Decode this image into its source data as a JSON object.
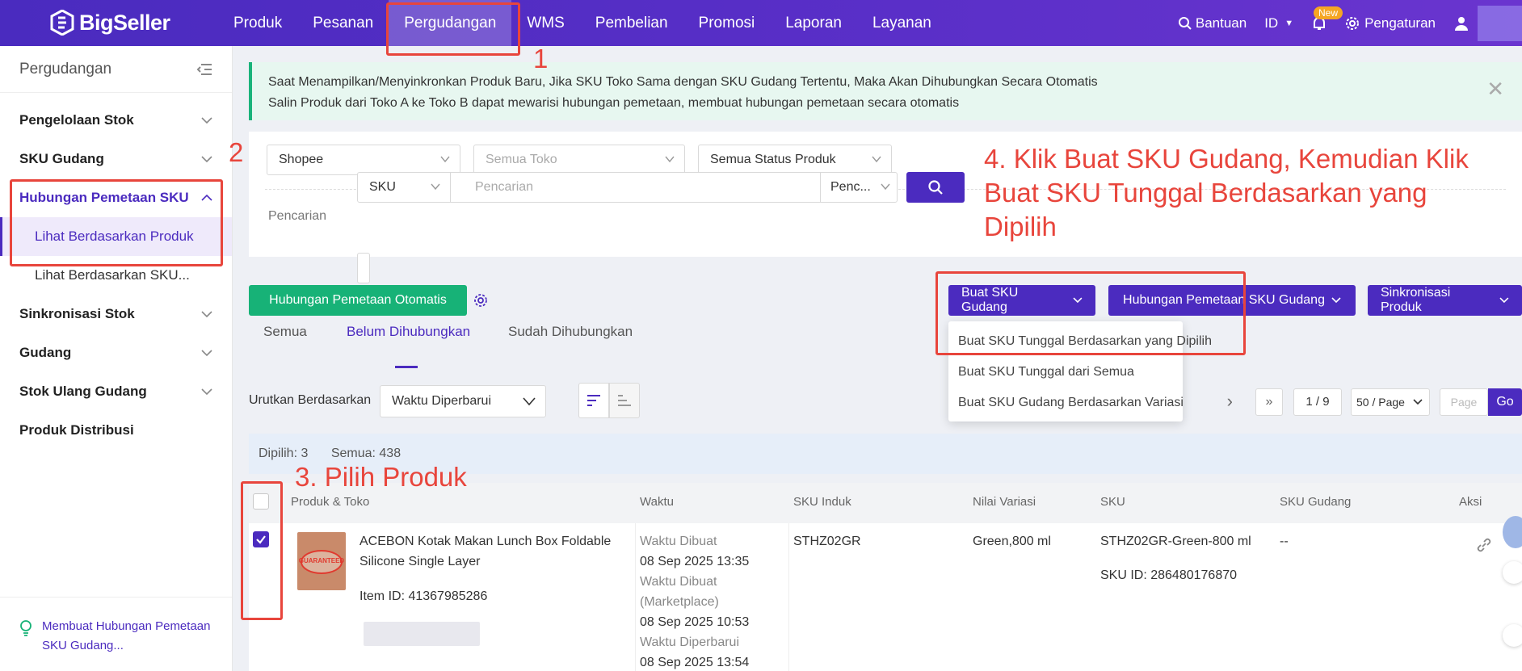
{
  "brand": {
    "name": "BigSeller",
    "accent": "#4b2bbf",
    "green": "#17b277",
    "annotation": "#e8453c"
  },
  "nav": {
    "items": [
      {
        "label": "Produk"
      },
      {
        "label": "Pesanan"
      },
      {
        "label": "Pergudangan"
      },
      {
        "label": "WMS"
      },
      {
        "label": "Pembelian"
      },
      {
        "label": "Promosi"
      },
      {
        "label": "Laporan"
      },
      {
        "label": "Layanan"
      }
    ],
    "active": "Pergudangan",
    "help_label": "Bantuan",
    "lang_label": "ID",
    "new_badge": "New",
    "settings_label": "Pengaturan"
  },
  "sidebar": {
    "title": "Pergudangan",
    "items": [
      {
        "label": "Pengelolaan Stok"
      },
      {
        "label": "SKU Gudang"
      },
      {
        "label": "Hubungan Pemetaan SKU"
      },
      {
        "label": "Sinkronisasi Stok"
      },
      {
        "label": "Gudang"
      },
      {
        "label": "Stok Ulang Gudang"
      },
      {
        "label": "Produk Distribusi"
      }
    ],
    "sub_items": [
      {
        "label": "Lihat Berdasarkan Produk"
      },
      {
        "label": "Lihat Berdasarkan SKU..."
      }
    ],
    "tip": "Membuat Hubungan Pemetaan SKU Gudang..."
  },
  "notice": {
    "line1": "Saat Menampilkan/Menyinkronkan Produk Baru, Jika SKU Toko Sama dengan SKU Gudang Tertentu, Maka Akan Dihubungkan Secara Otomatis",
    "line2": "Salin Produk dari Toko A ke Toko B dapat mewarisi hubungan pemetaan, membuat hubungan pemetaan secara otomatis"
  },
  "filters": {
    "platform": "Shopee",
    "store": "Semua Toko",
    "status": "Semua Status Produk",
    "search_label": "Pencarian",
    "search_field": "SKU",
    "search_placeholder": "Pencarian",
    "search_mode": "Penc..."
  },
  "toolbar": {
    "auto_map": "Hubungan Pemetaan Otomatis",
    "create_sku": "Buat SKU Gudang",
    "map_sku": "Hubungan Pemetaan SKU Gudang",
    "sync_product": "Sinkronisasi Produk"
  },
  "dropdown": {
    "items": [
      {
        "label": "Buat SKU Tunggal Berdasarkan yang Dipilih"
      },
      {
        "label": "Buat SKU Tunggal dari Semua"
      },
      {
        "label": "Buat SKU Gudang Berdasarkan Variasi"
      }
    ]
  },
  "tabs": [
    {
      "label": "Semua"
    },
    {
      "label": "Belum Dihubungkan"
    },
    {
      "label": "Sudah Dihubungkan"
    }
  ],
  "sort": {
    "label": "Urutkan Berdasarkan",
    "value": "Waktu Diperbarui"
  },
  "pager": {
    "current": "1 / 9",
    "page_size": "50 / Page",
    "page_placeholder": "Page",
    "go": "Go"
  },
  "selection": {
    "selected": "Dipilih: 3",
    "total": "Semua: 438"
  },
  "table": {
    "headers": [
      "Produk & Toko",
      "Waktu",
      "SKU Induk",
      "Nilai Variasi",
      "SKU",
      "SKU Gudang",
      "Aksi"
    ],
    "row": {
      "product_title": "ACEBON Kotak Makan Lunch Box Foldable Silicone Single Layer",
      "item_id": "Item ID: 41367985286",
      "thumb_badge": "GUARANTEED",
      "time_created_label": "Waktu Dibuat",
      "time_created": "08 Sep 2025 13:35",
      "time_marketplace_label": "Waktu Dibuat (Marketplace)",
      "time_marketplace": "08 Sep 2025 10:53",
      "time_updated_label": "Waktu Diperbarui",
      "time_updated": "08 Sep 2025 13:54",
      "parent_sku": "STHZ02GR",
      "variation": "Green,800 ml",
      "sku": "STHZ02GR-Green-800 ml",
      "sku_id": "SKU ID: 286480176870",
      "warehouse_sku": "--"
    }
  },
  "annotations": {
    "n1": "1",
    "n2": "2",
    "n3": "3. Pilih Produk",
    "n4": "4. Klik Buat SKU Gudang, Kemudian Klik Buat SKU Tunggal Berdasarkan yang Dipilih"
  }
}
